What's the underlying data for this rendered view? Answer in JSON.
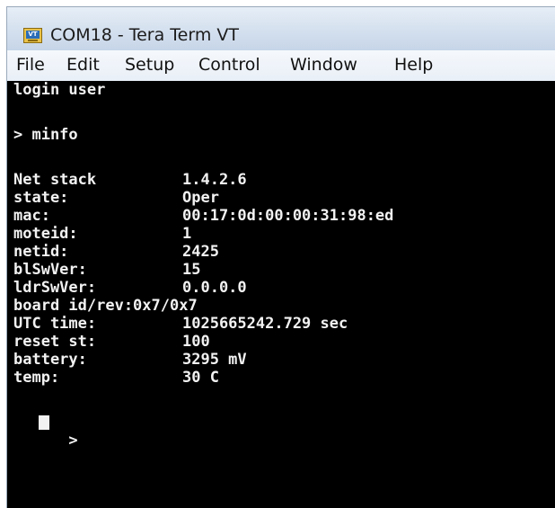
{
  "window": {
    "title": "COM18 - Tera Term VT",
    "icon_name": "tera-term-vt-icon",
    "icon_glyph": "VT"
  },
  "menu": {
    "items": [
      {
        "label": "File"
      },
      {
        "label": "Edit"
      },
      {
        "label": "Setup"
      },
      {
        "label": "Control"
      },
      {
        "label": "Window"
      },
      {
        "label": "Help"
      }
    ]
  },
  "terminal": {
    "login_line": "login user",
    "command_line": "> minfo",
    "fields": [
      {
        "key": "Net stack",
        "value": "1.4.2.6"
      },
      {
        "key": "state:",
        "value": "Oper"
      },
      {
        "key": "mac:",
        "value": "00:17:0d:00:00:31:98:ed"
      },
      {
        "key": "moteid:",
        "value": "1"
      },
      {
        "key": "netid:",
        "value": "2425"
      },
      {
        "key": "blSwVer:",
        "value": "15"
      },
      {
        "key": "ldrSwVer:",
        "value": "0.0.0.0"
      }
    ],
    "board_line": "board id/rev:0x7/0x7",
    "fields2": [
      {
        "key": "UTC time:",
        "value": "1025665242.729 sec"
      },
      {
        "key": "reset st:",
        "value": "100"
      },
      {
        "key": "battery:",
        "value": "3295 mV"
      },
      {
        "key": "temp:",
        "value": "30 C"
      }
    ],
    "prompt": ">",
    "colors": {
      "background": "#000000",
      "foreground": "#f2f2f2"
    }
  }
}
